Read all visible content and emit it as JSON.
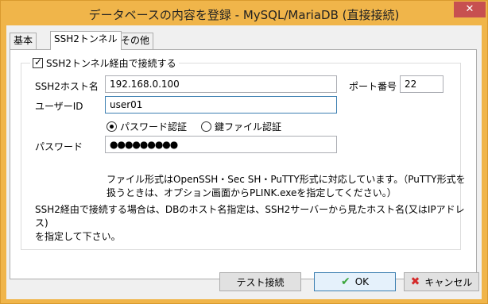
{
  "window": {
    "title": "データベースの内容を登録 - MySQL/MariaDB (直接接続)",
    "close_label": "✕"
  },
  "tabs": [
    {
      "label": "基本",
      "active": false
    },
    {
      "label": "SSH2トンネル",
      "active": true
    },
    {
      "label": "その他",
      "active": false
    }
  ],
  "ssh": {
    "use_tunnel_label": "SSH2トンネル経由で接続する",
    "use_tunnel_checked": true,
    "host_label": "SSH2ホスト名",
    "host_value": "192.168.0.100",
    "port_label": "ポート番号",
    "port_value": "22",
    "user_label": "ユーザーID",
    "user_value": "user01",
    "auth_password_label": "パスワード認証",
    "auth_key_label": "鍵ファイル認証",
    "selected_auth": "password",
    "password_label": "パスワード",
    "password_value": "●●●●●●●●●",
    "note_line1": "ファイル形式はOpenSSH・Sec SH・PuTTY形式に対応しています。（PuTTY形式を",
    "note_line2": "扱うときは、オプション画面からPLINK.exeを指定してください。）",
    "info_line1": "SSH2経由で接続する場合は、DBのホスト名指定は、SSH2サーバーから見たホスト名(又はIPアドレス)",
    "info_line2": "を指定して下さい。"
  },
  "buttons": {
    "test_label": "テスト接続",
    "ok_label": "OK",
    "cancel_label": "キャンセル"
  },
  "colors": {
    "titlebar": "#f0b54a",
    "close_button": "#c75050",
    "focus_border": "#3c7fb1"
  }
}
